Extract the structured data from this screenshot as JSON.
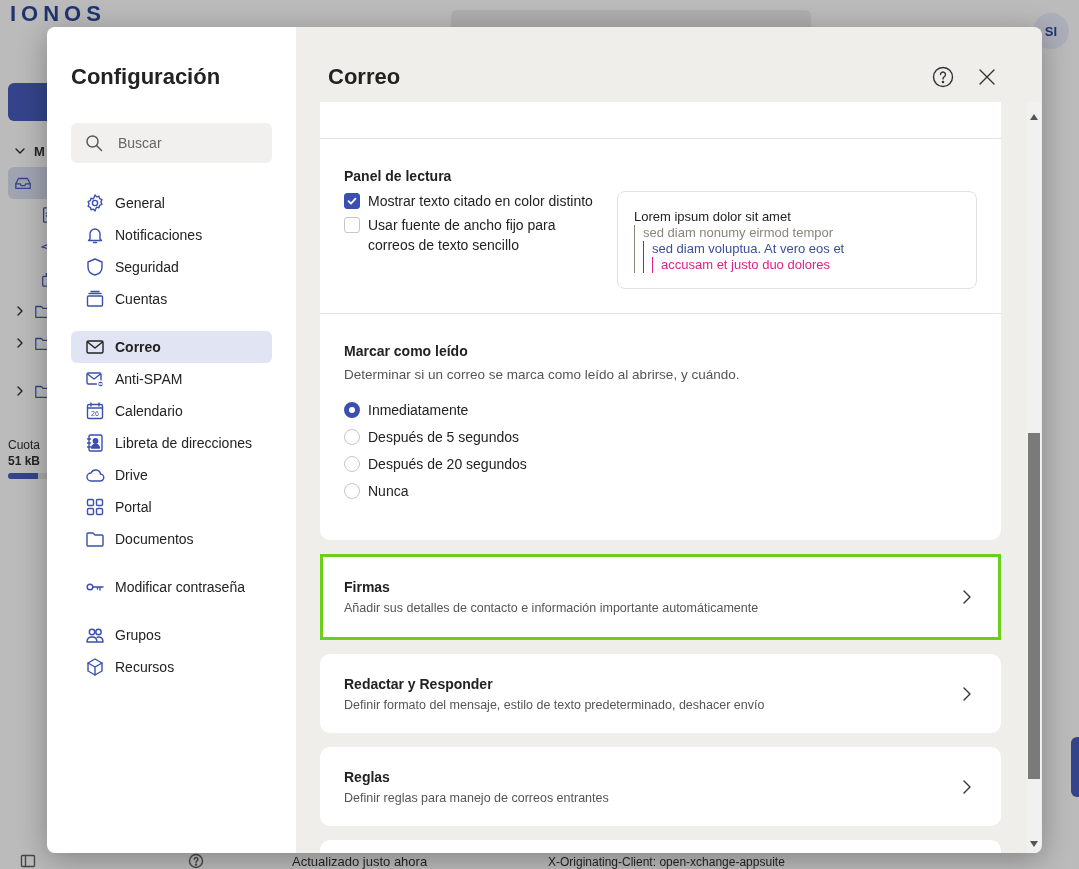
{
  "app": {
    "logo": "IONOS",
    "avatar": "SI",
    "folder": "M",
    "quota": {
      "label": "Cuota",
      "value": "51 kB",
      "level": 0.15
    },
    "status": "Actualizado justo ahora",
    "detail_line": "X-Originating-Client: open-xchange-appsuite"
  },
  "dialog": {
    "title": "Configuración",
    "search": {
      "placeholder": "Buscar"
    },
    "nav_groups": [
      [
        {
          "label": "General",
          "selected": false
        },
        {
          "label": "Notificaciones",
          "selected": false
        },
        {
          "label": "Seguridad",
          "selected": false
        },
        {
          "label": "Cuentas",
          "selected": false
        }
      ],
      [
        {
          "label": "Correo",
          "selected": true
        },
        {
          "label": "Anti-SPAM",
          "selected": false
        },
        {
          "label": "Calendario",
          "selected": false,
          "icon_text": "26"
        },
        {
          "label": "Libreta de direcciones",
          "selected": false
        },
        {
          "label": "Drive",
          "selected": false
        },
        {
          "label": "Portal",
          "selected": false
        },
        {
          "label": "Documentos",
          "selected": false
        }
      ],
      [
        {
          "label": "Modificar contraseña",
          "selected": false
        }
      ],
      [
        {
          "label": "Grupos",
          "selected": false
        },
        {
          "label": "Recursos",
          "selected": false
        }
      ]
    ]
  },
  "page": {
    "title": "Correo",
    "reading_pane": {
      "title": "Panel de lectura",
      "options": [
        {
          "label": "Mostrar texto citado en color distinto",
          "checked": true
        },
        {
          "label": "Usar fuente de ancho fijo para correos de texto sencillo",
          "checked": false
        }
      ],
      "preview": {
        "text": "Lorem ipsum dolor sit amet",
        "children": [
          {
            "text": "sed diam nonumy eirmod tempor",
            "color": "#8a857c",
            "children": [
              {
                "text": "sed diam voluptua. At vero eos et",
                "color": "#3a4e9c",
                "children": [
                  {
                    "text": "accusam et justo duo dolores",
                    "color": "#e0208c"
                  }
                ]
              }
            ]
          }
        ]
      }
    },
    "mark_read": {
      "title": "Marcar como leído",
      "description": "Determinar si un correo se marca como leído al abrirse, y cuándo.",
      "options": [
        {
          "label": "Inmediatamente",
          "selected": true
        },
        {
          "label": "Después de 5 segundos",
          "selected": false
        },
        {
          "label": "Después de 20 segundos",
          "selected": false
        },
        {
          "label": "Nunca",
          "selected": false
        }
      ]
    },
    "links": [
      {
        "title": "Firmas",
        "description": "Añadir sus detalles de contacto e información importante automáticamente",
        "highlighted": true
      },
      {
        "title": "Redactar y Responder",
        "description": "Definir formato del mensaje, estilo de texto predeterminado, deshacer envío",
        "highlighted": false
      },
      {
        "title": "Reglas",
        "description": "Definir reglas para manejo de correos entrantes",
        "highlighted": false
      }
    ]
  }
}
